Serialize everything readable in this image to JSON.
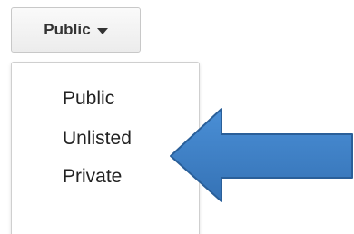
{
  "privacy_button": {
    "label": "Public",
    "icon": "caret-down-icon"
  },
  "privacy_menu": {
    "items": [
      {
        "label": "Public"
      },
      {
        "label": "Unlisted"
      },
      {
        "label": "Private"
      }
    ],
    "highlighted_item": "Unlisted"
  },
  "annotation": {
    "icon": "left-arrow-icon",
    "fill_color": "#3d7fc4",
    "stroke_color": "#2a5f99"
  }
}
